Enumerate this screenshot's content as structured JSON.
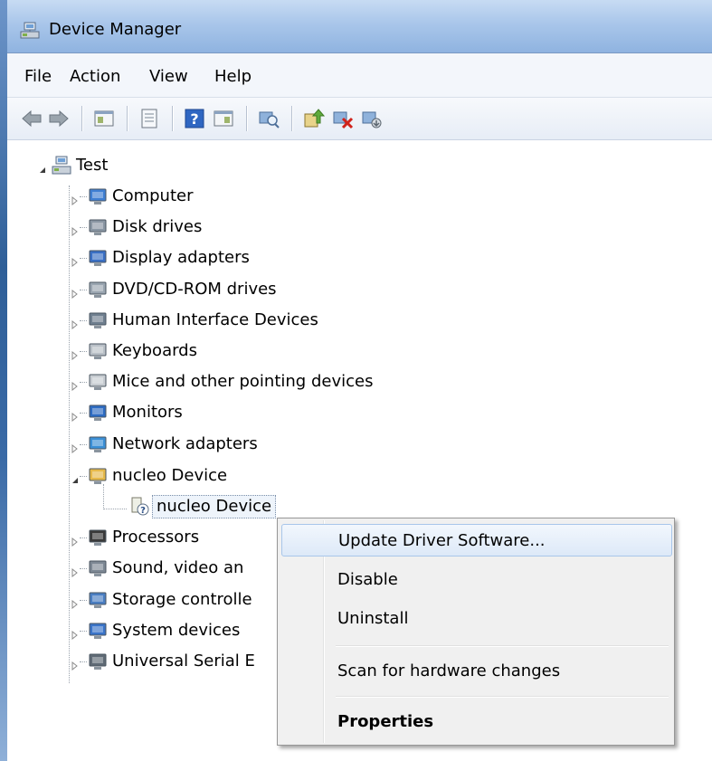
{
  "window": {
    "title": "Device Manager"
  },
  "menubar": {
    "items": [
      "File",
      "Action",
      "View",
      "Help"
    ]
  },
  "toolbar": {
    "buttons": [
      "back-icon",
      "forward-icon",
      "show-hide-tree-icon",
      "properties-icon",
      "help-icon",
      "view-icon",
      "scan-hardware-icon",
      "update-driver-icon",
      "uninstall-icon",
      "disable-icon"
    ]
  },
  "tree": {
    "root": "Test",
    "categories": [
      "Computer",
      "Disk drives",
      "Display adapters",
      "DVD/CD-ROM drives",
      "Human Interface Devices",
      "Keyboards",
      "Mice and other pointing devices",
      "Monitors",
      "Network adapters",
      "nucleo Device",
      "Processors",
      "Sound, video an",
      "Storage controlle",
      "System devices",
      "Universal Serial E"
    ],
    "selected_child": "nucleo Device"
  },
  "context_menu": {
    "items": [
      "Update Driver Software...",
      "Disable",
      "Uninstall",
      "Scan for hardware changes",
      "Properties"
    ]
  },
  "colors": {
    "titlebar": "#a9c6ea",
    "menu_highlight": "#dde9f8",
    "menu_bg": "#f0f0f0"
  }
}
